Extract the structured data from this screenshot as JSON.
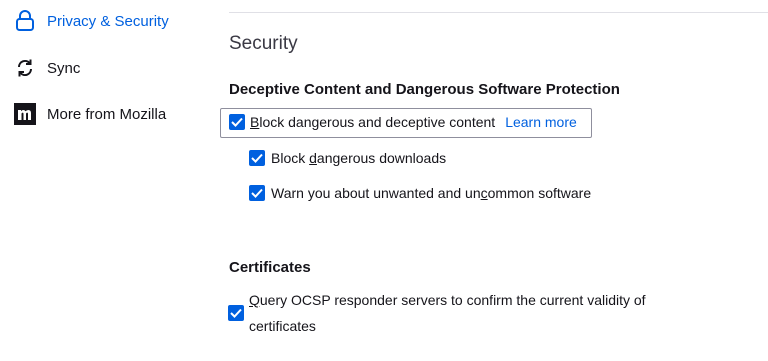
{
  "sidebar": {
    "items": [
      {
        "label": "Privacy & Security",
        "icon": "lock-icon",
        "selected": true
      },
      {
        "label": "Sync",
        "icon": "sync-icon",
        "selected": false
      },
      {
        "label": "More from Mozilla",
        "icon": "mozilla-icon",
        "selected": false
      }
    ]
  },
  "main": {
    "section_title": "Security",
    "deceptive": {
      "heading": "Deceptive Content and Dangerous Software Protection",
      "block_content": {
        "first_letter": "B",
        "rest": "lock dangerous and deceptive content",
        "checked": true,
        "learn_more": "Learn more"
      },
      "block_downloads": {
        "before": "Block ",
        "underlined": "d",
        "after": "angerous downloads",
        "checked": true
      },
      "warn_unwanted": {
        "before": "Warn you about unwanted and un",
        "underlined": "c",
        "after": "ommon software",
        "checked": true
      }
    },
    "certificates": {
      "heading": "Certificates",
      "query_ocsp": {
        "first_letter": "Q",
        "line1_rest": "uery OCSP responder servers to confirm the current validity of",
        "line2": "certificates",
        "checked": true
      }
    }
  },
  "colors": {
    "accent": "#0060df",
    "text": "#15141a",
    "focus_border": "#8f8f9d"
  }
}
